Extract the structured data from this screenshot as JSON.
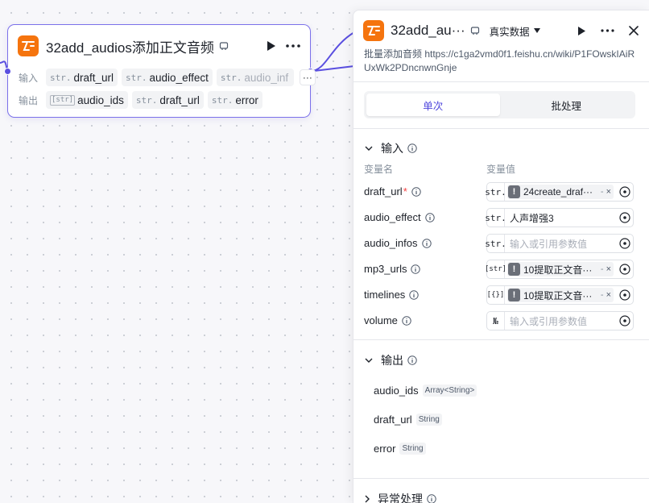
{
  "colors": {
    "accent": "#5a4fe0",
    "node_border": "#7b70ea",
    "logo_bg": "#f5740e",
    "required": "#f53f3f"
  },
  "node": {
    "title": "32add_audios添加正文音频",
    "logo_icon": "plugin-logo-icon",
    "input_label": "输入",
    "output_label": "输出",
    "inputs": [
      {
        "type": "str.",
        "name": "draft_url"
      },
      {
        "type": "str.",
        "name": "audio_effect"
      },
      {
        "type": "str.",
        "name": "audio_inf"
      }
    ],
    "more_label": "···",
    "outputs": [
      {
        "type": "[str]",
        "name": "audio_ids"
      },
      {
        "type": "str.",
        "name": "draft_url"
      },
      {
        "type": "str.",
        "name": "error"
      }
    ]
  },
  "panel": {
    "title": "32add_au···",
    "data_select": "真实数据",
    "description": "批量添加音频 https://c1ga2vmd0f1.feishu.cn/wiki/P1FOwskIAiRUxWk2PDncnwnGnje",
    "tabs": [
      {
        "label": "单次",
        "active": true
      },
      {
        "label": "批处理",
        "active": false
      }
    ],
    "input_section": {
      "title": "输入",
      "col_name": "变量名",
      "col_value": "变量值",
      "params": [
        {
          "name": "draft_url",
          "required": true,
          "type": "str.",
          "kind": "ref",
          "value": "24create_draf···"
        },
        {
          "name": "audio_effect",
          "required": false,
          "type": "str.",
          "kind": "text",
          "value": "人声增强3"
        },
        {
          "name": "audio_infos",
          "required": false,
          "type": "str.",
          "kind": "placeholder",
          "value": "输入或引用参数值"
        },
        {
          "name": "mp3_urls",
          "required": false,
          "type": "[str]",
          "kind": "ref",
          "value": "10提取正文音···"
        },
        {
          "name": "timelines",
          "required": false,
          "type": "[{}]",
          "kind": "ref",
          "value": "10提取正文音···"
        },
        {
          "name": "volume",
          "required": false,
          "type": "№",
          "kind": "placeholder",
          "value": "输入或引用参数值"
        }
      ]
    },
    "output_section": {
      "title": "输出",
      "items": [
        {
          "name": "audio_ids",
          "type": "Array<String>"
        },
        {
          "name": "draft_url",
          "type": "String"
        },
        {
          "name": "error",
          "type": "String"
        }
      ]
    },
    "exception_section": {
      "title": "异常处理"
    }
  }
}
